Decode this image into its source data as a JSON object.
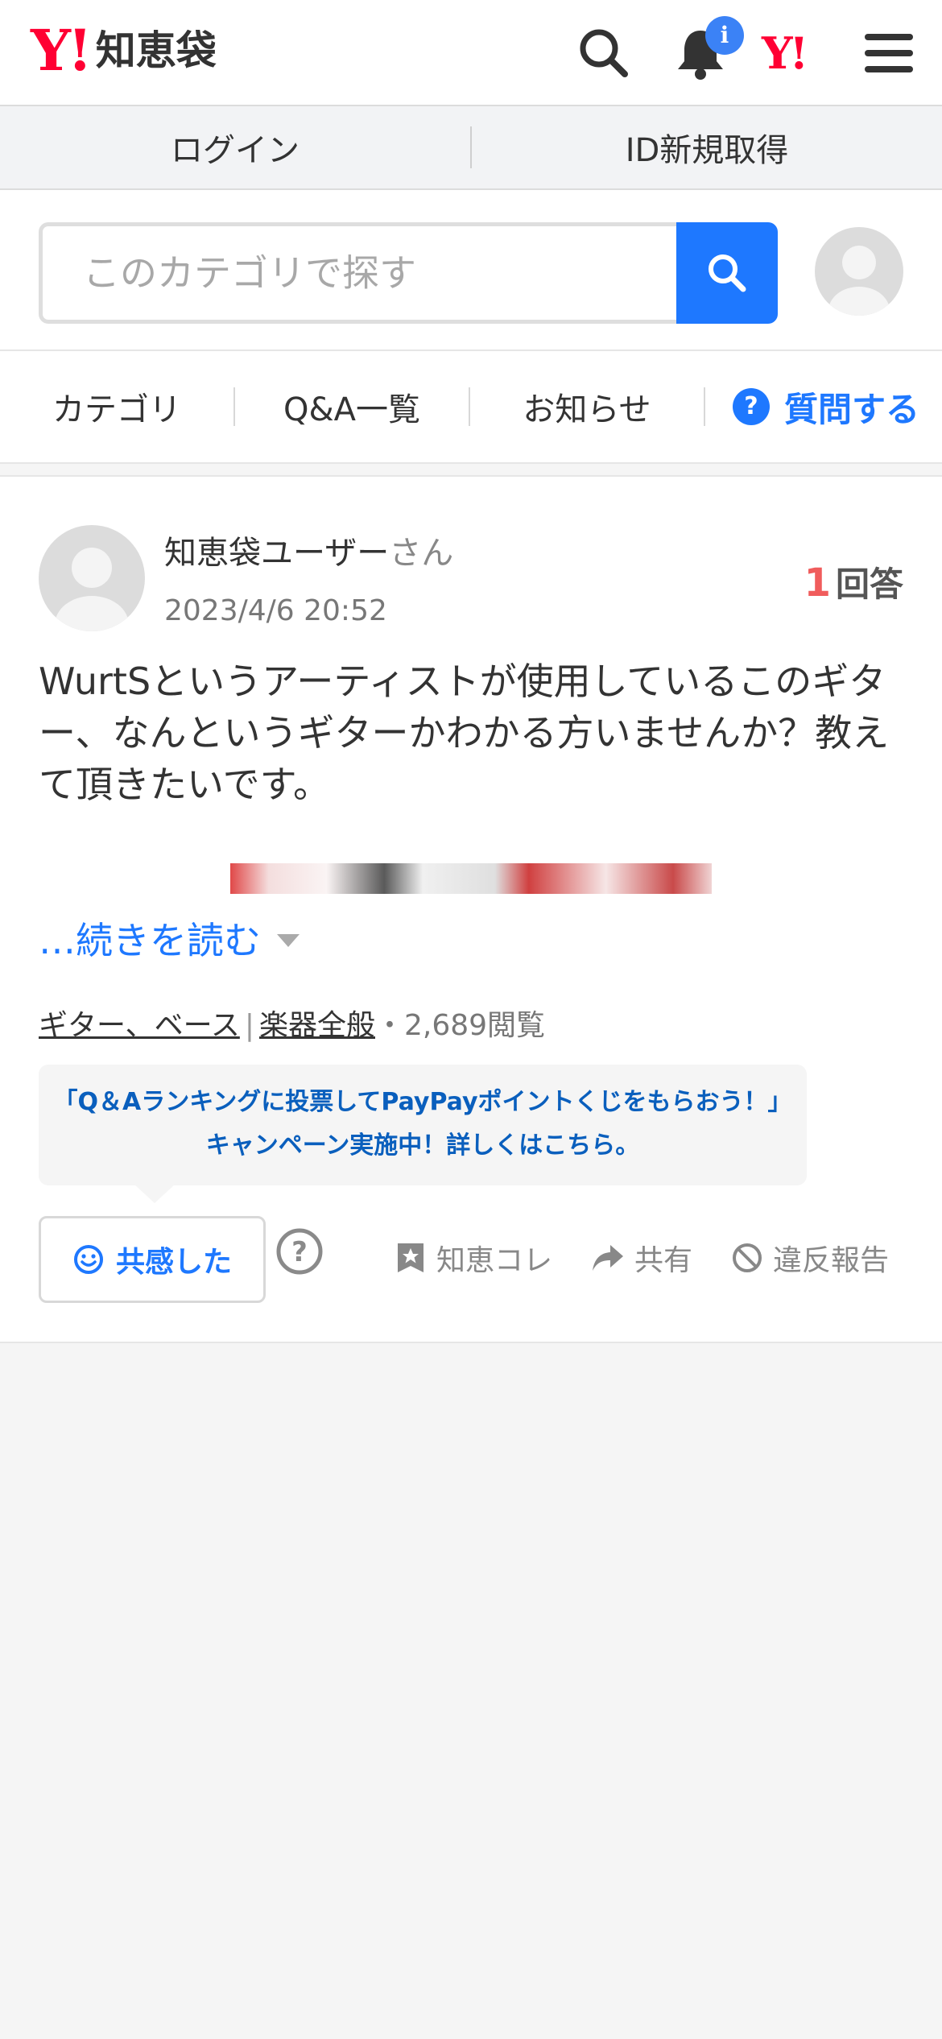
{
  "header": {
    "logo_mark": "Y!",
    "logo_text": "知恵袋",
    "notification_badge": "i",
    "yahoo_mark": "Y!"
  },
  "login_bar": {
    "login": "ログイン",
    "register": "ID新規取得"
  },
  "search": {
    "placeholder": "このカテゴリで探す"
  },
  "nav": {
    "category": "カテゴリ",
    "qa_list": "Q&A一覧",
    "news": "お知らせ",
    "ask_icon": "?",
    "ask": "質問する"
  },
  "question": {
    "user_name": "知恵袋ユーザー",
    "user_suffix": "さん",
    "date": "2023/4/6 20:52",
    "answer_count": "1",
    "answer_label": "回答",
    "text": "WurtSというアーティストが使用しているこのギター、なんというギターかわかる方いませんか？教えて頂きたいです。",
    "read_more": "…続きを読む",
    "category1": "ギター、ベース",
    "category_sep": "|",
    "category2": "楽器全般",
    "views": "・2,689閲覧"
  },
  "campaign": {
    "line1": "「Q＆Aランキングに投票してPayPayポイントくじをもらおう！」",
    "line2": "キャンペーン実施中！詳しくはこちら。"
  },
  "actions": {
    "empathy": "共感した",
    "help": "?",
    "collect": "知恵コレ",
    "share": "共有",
    "report": "違反報告"
  },
  "colors": {
    "brand_red": "#ff0033",
    "link_blue": "#1e78ff",
    "answer_red": "#f05c5c"
  }
}
